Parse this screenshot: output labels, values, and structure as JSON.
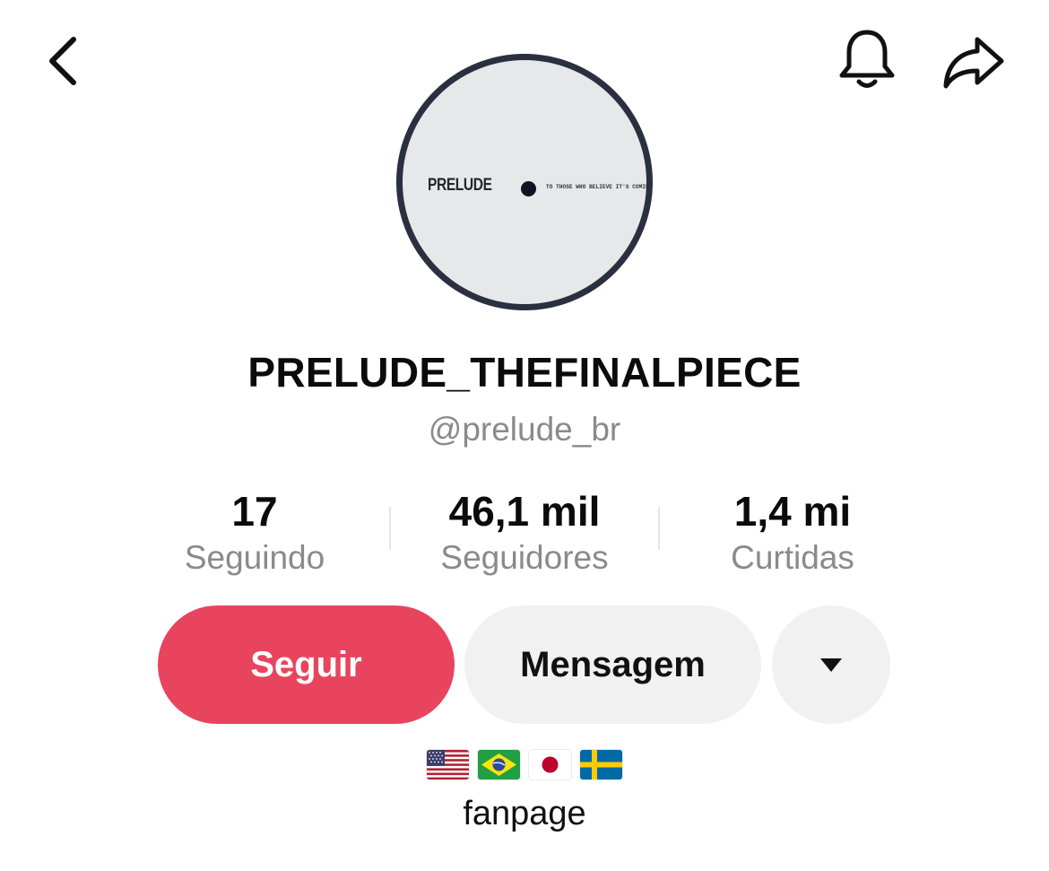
{
  "header": {
    "back_icon": "chevron-left-icon",
    "bell_icon": "bell-icon",
    "share_icon": "share-arrow-icon"
  },
  "avatar": {
    "record_title": "PRELUDE",
    "record_tagline": "TO THOSE WHO BELIEVE IT'S COMING",
    "ring_color": "#2a3040",
    "label_color": "#e7e8ea"
  },
  "profile": {
    "display_name": "PRELUDE_THEFINALPIECE",
    "handle": "@prelude_br"
  },
  "stats": [
    {
      "value": "17",
      "label": "Seguindo"
    },
    {
      "value": "46,1 mil",
      "label": "Seguidores"
    },
    {
      "value": "1,4 mi",
      "label": "Curtidas"
    }
  ],
  "actions": {
    "follow_label": "Seguir",
    "message_label": "Mensagem",
    "more_icon": "caret-down-icon",
    "follow_color": "#e9445e",
    "secondary_color": "#f1f1f2"
  },
  "bio": {
    "flags": [
      "flag-us",
      "flag-br",
      "flag-jp",
      "flag-se"
    ],
    "text": "fanpage"
  }
}
